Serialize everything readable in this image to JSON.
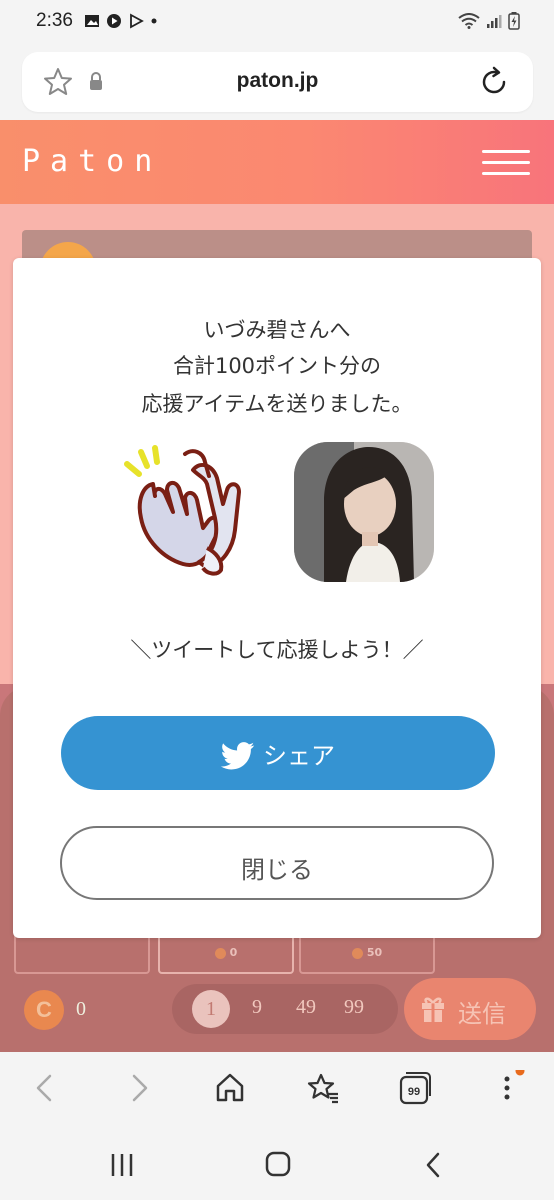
{
  "status_bar": {
    "time": "2:36"
  },
  "browser": {
    "url": "paton.jp"
  },
  "site": {
    "logo": "Paton"
  },
  "modal": {
    "line1": "いづみ碧さんへ",
    "line2": "合計100ポイント分の",
    "line3": "応援アイテムを送りました。",
    "tweet_prompt": "＼ツイートして応援しよう！／",
    "share_label": "シェア",
    "close_label": "閉じる"
  },
  "tiles": [
    {
      "points": ""
    },
    {
      "points": "0"
    },
    {
      "points": "50"
    }
  ],
  "bottom": {
    "coin_symbol": "C",
    "balance": "0",
    "amounts": [
      "1",
      "9",
      "49",
      "99"
    ],
    "send_label": "送信"
  },
  "colors": {
    "header_gradient_start": "#f98f6b",
    "header_gradient_end": "#f8747b",
    "share_button": "#3593d2"
  }
}
